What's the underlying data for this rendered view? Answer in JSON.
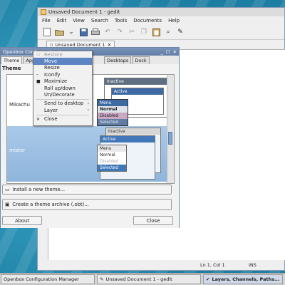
{
  "gedit": {
    "title": "Unsaved Document 1 - gedit",
    "menu": [
      "File",
      "Edit",
      "View",
      "Search",
      "Tools",
      "Documents",
      "Help"
    ],
    "tab_label": "Unsaved Document 1",
    "status_position": "Ln 1, Col 1",
    "status_mode": "INS"
  },
  "obconf": {
    "title": "Openbox Configuration Manager",
    "tabs": [
      "Theme",
      "Appea",
      "Desktops",
      "Dock"
    ],
    "section_label": "Theme",
    "themes": [
      {
        "name": "Mikachu"
      },
      {
        "name": "mister"
      }
    ],
    "preview": {
      "inactive": "Inactive",
      "active": "Active",
      "menu_title": "Menu",
      "menu_items": [
        "Normal",
        "Disabled",
        "Selected"
      ]
    },
    "install_button": "Install a new theme...",
    "archive_button": "Create a theme archive (.obt)...",
    "about_button": "About",
    "close_button": "Close"
  },
  "context_menu": {
    "items": [
      {
        "label": "Restore",
        "state": "disabled",
        "icon": "restore-icon"
      },
      {
        "label": "Move",
        "state": "selected",
        "icon": ""
      },
      {
        "label": "Resize",
        "state": "normal",
        "icon": ""
      },
      {
        "label": "Iconify",
        "state": "normal",
        "icon": "iconify-icon"
      },
      {
        "label": "Maximize",
        "state": "normal",
        "icon": "maximize-icon"
      },
      {
        "label": "Roll up/down",
        "state": "normal",
        "icon": ""
      },
      {
        "label": "Un/Decorate",
        "state": "normal",
        "icon": ""
      },
      {
        "label": "Send to desktop",
        "state": "submenu",
        "icon": ""
      },
      {
        "label": "Layer",
        "state": "submenu",
        "icon": ""
      },
      {
        "label": "Close",
        "state": "normal",
        "icon": "close-icon"
      }
    ]
  },
  "taskbar": {
    "items": [
      {
        "label": "Openbox Configuration Manager"
      },
      {
        "label": "Unsaved Document 1 - gedit"
      },
      {
        "label": "Layers, Channels, Paths..."
      }
    ]
  }
}
